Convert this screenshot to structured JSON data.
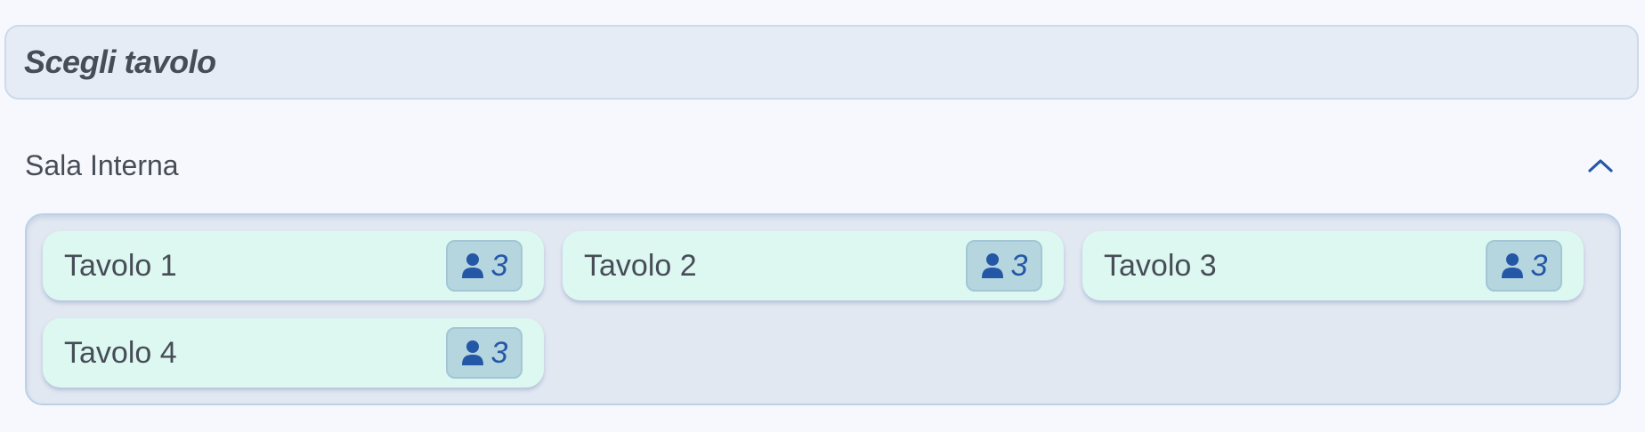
{
  "header": {
    "title": "Scegli tavolo"
  },
  "section": {
    "title": "Sala Interna",
    "toggle_icon": "chevron-up-icon"
  },
  "tables": [
    {
      "name": "Tavolo 1",
      "seats": "3",
      "icon": "person-icon"
    },
    {
      "name": "Tavolo 2",
      "seats": "3",
      "icon": "person-icon"
    },
    {
      "name": "Tavolo 3",
      "seats": "3",
      "icon": "person-icon"
    },
    {
      "name": "Tavolo 4",
      "seats": "3",
      "icon": "person-icon"
    }
  ],
  "colors": {
    "accent": "#2457a6",
    "card_background": "#dcf8f1",
    "badge_background": "#b6d6df",
    "panel_background": "#e2e8f2",
    "text": "#474d57"
  }
}
